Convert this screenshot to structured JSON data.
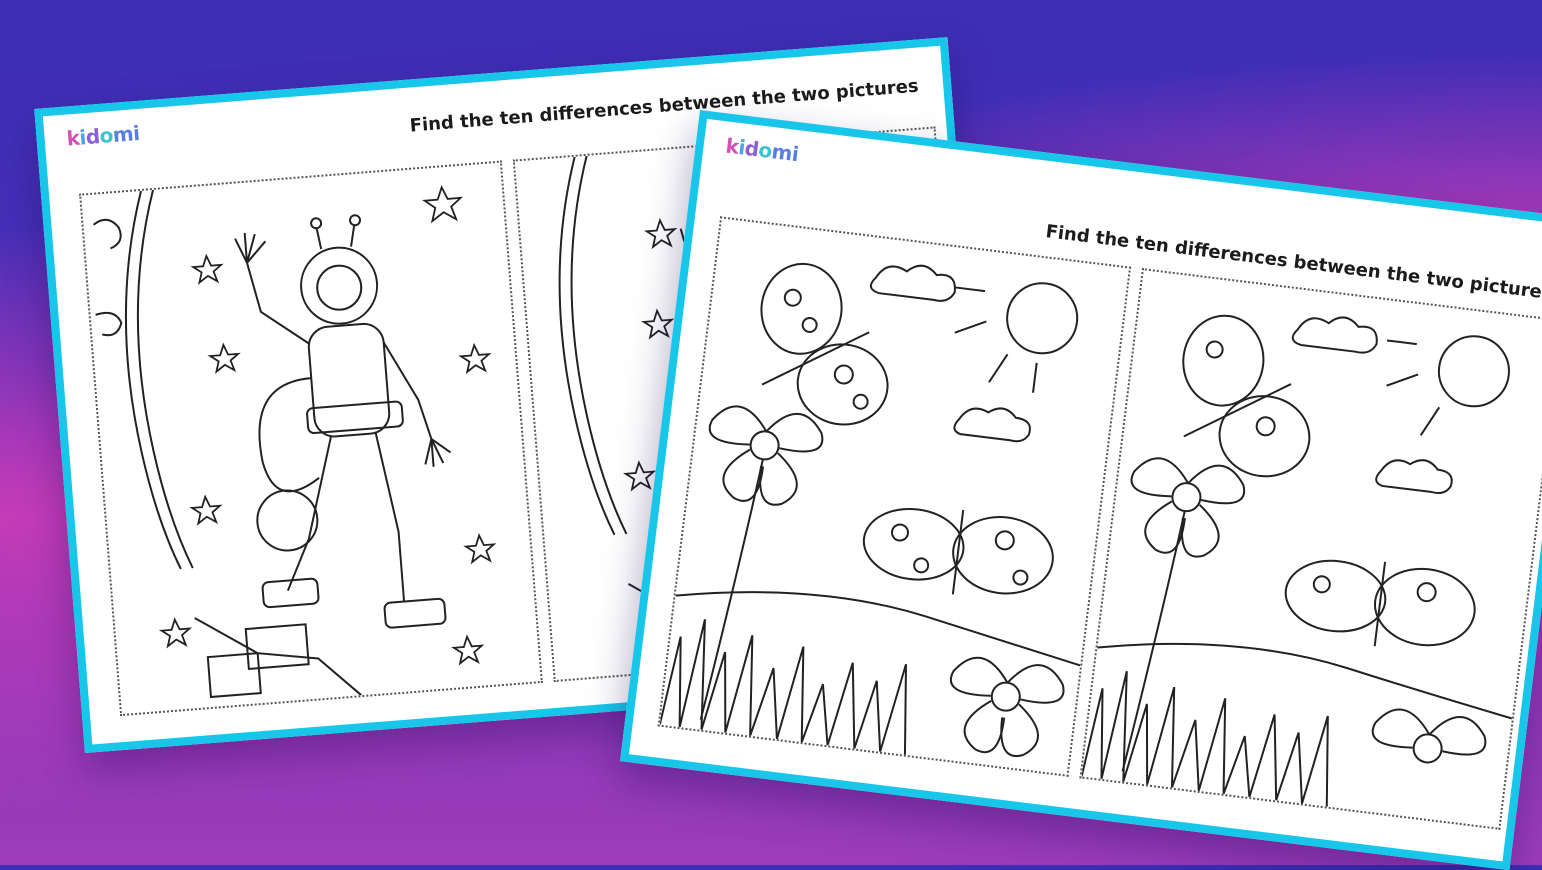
{
  "worksheet_space": {
    "logo_letters": [
      "k",
      "i",
      "d",
      "o",
      "mi"
    ],
    "title": "Find the ten differences between the two pictures"
  },
  "worksheet_garden": {
    "logo_letters": [
      "k",
      "i",
      "d",
      "o",
      "mi"
    ],
    "title": "Find the ten differences between the two pictures"
  },
  "colors": {
    "border": "#18c6ea",
    "background_top": "#3d2eb5",
    "background_bottom": "#9c3cbc",
    "accent_pink": "#d23bb4"
  }
}
